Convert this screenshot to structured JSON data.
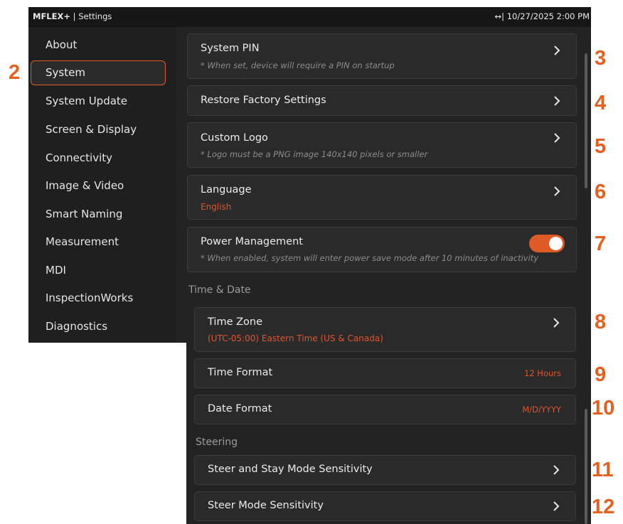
{
  "topbar": {
    "brand": "MFLEX+",
    "separator": " | ",
    "app_section": "Settings",
    "status_text": "↔| 10/27/2025 2:00 PM"
  },
  "sidebar": {
    "items": [
      {
        "label": "About"
      },
      {
        "label": "System"
      },
      {
        "label": "System Update"
      },
      {
        "label": "Screen & Display"
      },
      {
        "label": "Connectivity"
      },
      {
        "label": "Image & Video"
      },
      {
        "label": "Smart Naming"
      },
      {
        "label": "Measurement"
      },
      {
        "label": "MDI"
      },
      {
        "label": "InspectionWorks"
      },
      {
        "label": "Diagnostics"
      }
    ],
    "selected": "System"
  },
  "settings": {
    "system_pin": {
      "title": "System PIN",
      "note": "* When set, device will require a PIN on startup"
    },
    "restore": {
      "title": "Restore Factory Settings"
    },
    "custom_logo": {
      "title": "Custom Logo",
      "note": "* Logo must be a PNG image 140x140 pixels or smaller"
    },
    "language": {
      "title": "Language",
      "value": "English"
    },
    "power": {
      "title": "Power Management",
      "note": "* When enabled, system will enter power save mode after 10 minutes of inactivity",
      "enabled": true
    },
    "time_date_header": "Time & Date",
    "time_zone": {
      "title": "Time Zone",
      "value": "(UTC-05:00) Eastern Time (US & Canada)"
    },
    "time_format": {
      "title": "Time Format",
      "value": "12 Hours"
    },
    "date_format": {
      "title": "Date Format",
      "value": "M/D/YYYY"
    },
    "steering_header": "Steering",
    "steer_stay": {
      "title": "Steer and Stay Mode Sensitivity"
    },
    "steer_mode": {
      "title": "Steer Mode Sensitivity"
    }
  },
  "callouts": [
    "2",
    "3",
    "4",
    "5",
    "6",
    "7",
    "8",
    "9",
    "10",
    "11",
    "12"
  ],
  "colors": {
    "accent": "#e05a25",
    "callout": "#e5601f",
    "background": "#232323",
    "card": "#2a2a2a"
  },
  "icons": {
    "chevron": "chevron-right-icon",
    "toggle": "toggle-switch"
  }
}
